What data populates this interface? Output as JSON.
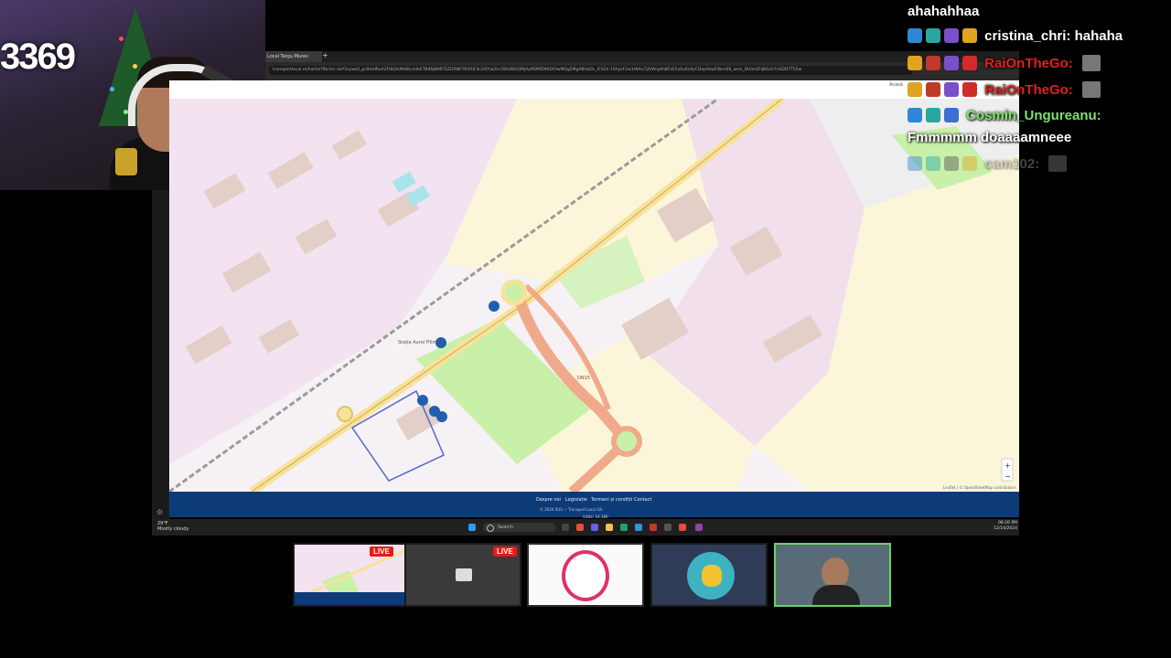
{
  "stream": {
    "counter": "3369"
  },
  "browser": {
    "tab_title": "Local Targu Mures",
    "new_tab": "+",
    "url": "transportlocal.ro/harta/?fbclid=IwY2xjawO_ps9leHRuA2FlbQIxMABicmlkETB4NjNMFI5ZDRNFYKlVUF4c2I0Yw2hcFBfaWQQMjAyMDM5M4OOlwMDg5MgABHsDL_lCS2h-1ShyzF2w1tNAuTjIVWrgAhBFzE5oSvKcKyCDop0zwF0bm08_aem_DUlm2FqN1zV7vSDD7TS5w",
    "acasa": "Acasă"
  },
  "footer": {
    "links": [
      "Despre noi",
      "Legislație",
      "Termeni și condiții",
      "Contact"
    ],
    "copyright": "© 2024 SUS — Transport Local SA",
    "visits": "Vizite: 14,180"
  },
  "taskbar": {
    "weather_temp": "29°F",
    "weather_desc": "Mostly cloudy",
    "search_placeholder": "Search",
    "time": "08:26 PM",
    "date": "12/16/2024"
  },
  "chat": {
    "messages": [
      {
        "user": "",
        "text": "ahahahhaa",
        "user_color": "#ffffff"
      },
      {
        "user": "cristina_chri:",
        "text": "hahaha",
        "user_color": "#ffffff"
      },
      {
        "user": "RaiOnTheGo:",
        "text": "",
        "user_color": "#e02020"
      },
      {
        "user": "RaiOnTheGo:",
        "text": "",
        "user_color": "#e02020"
      },
      {
        "user": "Cosmin_Ungureanu:",
        "text": "Fmmmmm doaaaamneee",
        "user_color": "#7be36a"
      },
      {
        "user": "cam102:",
        "text": "",
        "user_color": "#9a9a9a"
      }
    ]
  },
  "thumbnails": {
    "live_label": "LIVE"
  },
  "map": {
    "labels": {
      "bus_stop_1": "Stația Aurel Filimon",
      "road": "DN15",
      "attribution": "Leaflet | © OpenStreetMap contributors",
      "zoom_in": "+",
      "zoom_out": "−"
    }
  },
  "colors": {
    "footer_blue": "#0d3b78",
    "map_residential": "#f3e2ef",
    "map_park": "#c8f0a8",
    "map_field": "#fbf6d9",
    "road_orange": "#f0a98a",
    "road_yellow": "#f6e39a",
    "bus_stop_blue": "#1f5fb0"
  }
}
